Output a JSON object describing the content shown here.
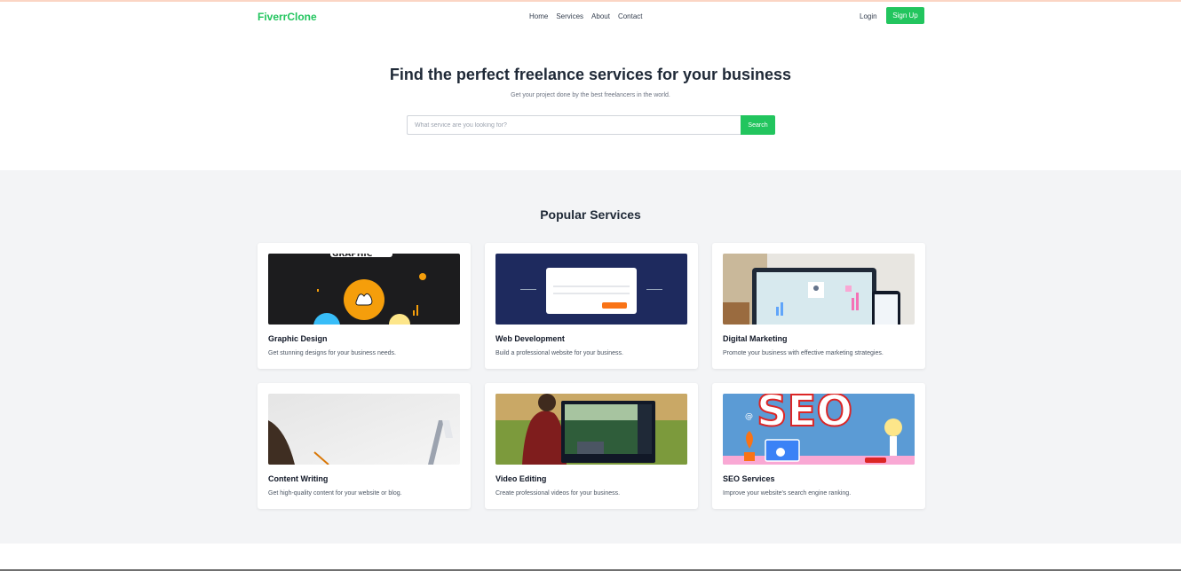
{
  "nav": {
    "logo": "FiverrClone",
    "links": [
      "Home",
      "Services",
      "About",
      "Contact"
    ],
    "login": "Login",
    "signup": "Sign Up"
  },
  "hero": {
    "title": "Find the perfect freelance services for your business",
    "subtitle": "Get your project done by the best freelancers in the world.",
    "search_placeholder": "What service are you looking for?",
    "search_button": "Search"
  },
  "services": {
    "title": "Popular Services",
    "items": [
      {
        "title": "Graphic Design",
        "desc": "Get stunning designs for your business needs.",
        "image": "graphic-design-illustration"
      },
      {
        "title": "Web Development",
        "desc": "Build a professional website for your business.",
        "image": "web-development-illustration"
      },
      {
        "title": "Digital Marketing",
        "desc": "Promote your business with effective marketing strategies.",
        "image": "digital-marketing-photo"
      },
      {
        "title": "Content Writing",
        "desc": "Get high-quality content for your website or blog.",
        "image": "content-writing-photo"
      },
      {
        "title": "Video Editing",
        "desc": "Create professional videos for your business.",
        "image": "video-editing-photo"
      },
      {
        "title": "SEO Services",
        "desc": "Improve your website's search engine ranking.",
        "image": "seo-illustration"
      }
    ]
  },
  "colors": {
    "brand": "#22c55e",
    "section_bg": "#f3f4f6"
  }
}
